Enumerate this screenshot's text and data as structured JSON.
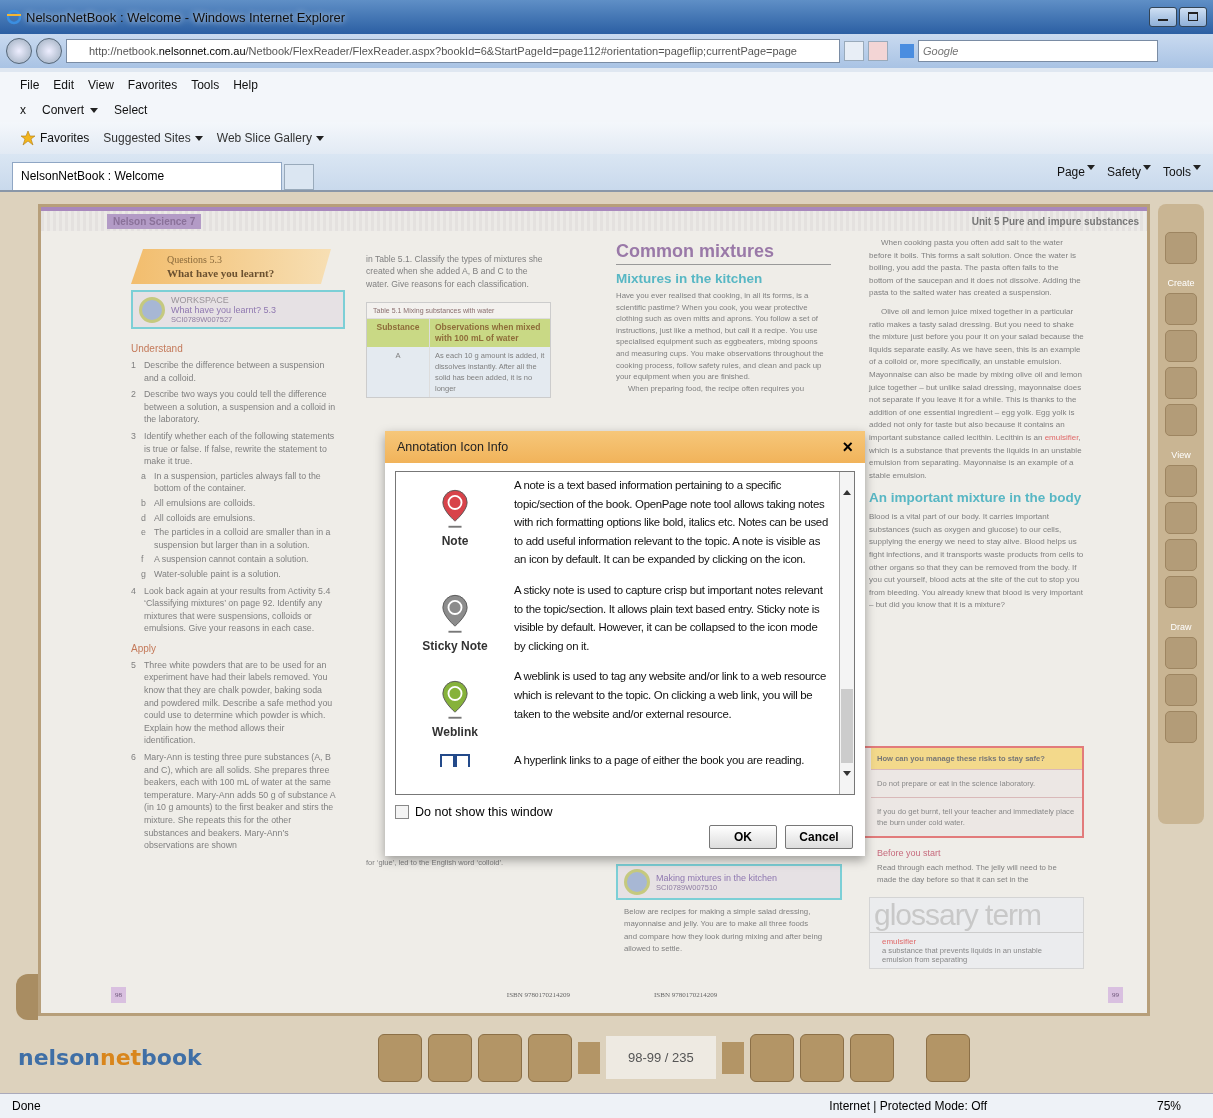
{
  "window": {
    "title": "NelsonNetBook : Welcome - Windows Internet Explorer"
  },
  "address_bar": {
    "url_start": "http://netbook.",
    "url_domain": "nelsonnet.com.au",
    "url_rest": "/Netbook/FlexReader/FlexReader.aspx?bookId=6&StartPageId=page112#orientation=pageflip;currentPage=page",
    "search_placeholder": "Google"
  },
  "menu": [
    "File",
    "Edit",
    "View",
    "Favorites",
    "Tools",
    "Help"
  ],
  "command_bar": {
    "close": "x",
    "convert": "Convert",
    "select": "Select"
  },
  "favorites_bar": {
    "favorites": "Favorites",
    "items": [
      "Suggested Sites",
      "Web Slice Gallery"
    ]
  },
  "tabs": [
    {
      "label": "NelsonNetBook : Welcome",
      "selected": true
    }
  ],
  "tab_commands": [
    "Page",
    "Safety",
    "Tools"
  ],
  "left_page": {
    "series": "Nelson Science 7",
    "questions_label": "Questions 5.3",
    "questions_title": "What have you learnt?",
    "workspace": {
      "label": "WORKSPACE",
      "title": "What have you learnt? 5.3",
      "code": "SCI0789W007527"
    },
    "sections": [
      {
        "heading": "Understand",
        "items": [
          {
            "num": "1",
            "text": "Describe the difference between a suspension and a colloid."
          },
          {
            "num": "2",
            "text": "Describe two ways you could tell the difference between a solution, a suspension and a colloid in the laboratory."
          },
          {
            "num": "3",
            "text": "Identify whether each of the following statements is true or false. If false, rewrite the statement to make it true.",
            "children": [
              {
                "num": "a",
                "text": "In a suspension, particles always fall to the bottom of the container."
              },
              {
                "num": "b",
                "text": "All emulsions are colloids."
              },
              {
                "num": "d",
                "text": "All colloids are emulsions."
              },
              {
                "num": "e",
                "text": "The particles in a colloid are smaller than in a suspension but larger than in a solution."
              },
              {
                "num": "f",
                "text": "A suspension cannot contain a solution."
              },
              {
                "num": "g",
                "text": "Water-soluble paint is a solution."
              }
            ]
          },
          {
            "num": "4",
            "text": "Look back again at your results from Activity 5.4 ‘Classifying mixtures’ on page 92. Identify any mixtures that were suspensions, colloids or emulsions. Give your reasons in each case."
          }
        ]
      },
      {
        "heading": "Apply",
        "items": [
          {
            "num": "5",
            "text": "Three white powders that are to be used for an experiment have had their labels removed. You know that they are chalk powder, baking soda and powdered milk. Describe a safe method you could use to determine which powder is which. Explain how the method allows their identification."
          },
          {
            "num": "6",
            "text": "Mary-Ann is testing three pure substances (A, B and C), which are all solids. She prepares three beakers, each with 100 mL of water at the same temperature. Mary-Ann adds 50 g of substance A (in 10 g amounts) to the first beaker and stirs the mixture. She repeats this for the other substances and beakers. Mary-Ann’s observations are shown"
          }
        ]
      }
    ],
    "intro": "in Table 5.1. Classify the types of mixtures she created when she added A, B and C to the water. Give reasons for each classification.",
    "table": {
      "caption": "Table 5.1 Mixing substances with water",
      "columns": [
        "Substance",
        "Observations when mixed with 100 mL of water"
      ],
      "rows": [
        [
          "A",
          "As each 10 g amount is added, it dissolves instantly. After all the solid has been added, it is no longer"
        ]
      ]
    },
    "tail": "for ‘glue’, led to the English word ‘colloid’.",
    "page_number": "98",
    "isbn": "ISBN 9780170214209"
  },
  "right_page": {
    "unit": "Unit 5 Pure and impure substances",
    "title": "Common mixtures",
    "heading": "Mixtures in the kitchen",
    "paragraphs": [
      "Have you ever realised that cooking, in all its forms, is a scientific pastime? When you cook, you wear protective clothing such as oven mitts and aprons. You follow a set of instructions, just like a method, but call it a recipe. You use specialised equipment such as eggbeaters, mixing spoons and measuring cups. You make observations throughout the cooking process, follow safety rules, and clean and pack up your equipment when you are finished.",
      "When preparing food, the recipe often requires you"
    ],
    "column2": [
      {
        "segments": [
          {
            "text": "When cooking pasta you often add salt to the water before it boils. This forms a salt solution. Once the water is boiling, you add the pasta. The pasta often falls to the bottom of the saucepan and it does not dissolve. Adding the pasta to the salted water has created a suspension."
          }
        ]
      },
      {
        "segments": [
          {
            "text": "Olive oil and lemon juice mixed together in a particular ratio makes a tasty salad dressing. But you need to shake the mixture just before you pour it on your salad because the liquids separate easily. As we have seen, this is an example of a colloid or, more specifically, an unstable emulsion. Mayonnaise can also be made by mixing olive oil and lemon juice together – but unlike salad dressing, mayonnaise does not separate if you leave it for a while. This is thanks to the addition of one essential ingredient – egg yolk. Egg yolk is added not only for taste but also because it contains an important substance called lecithin. Lecithin is an "
          },
          {
            "text": "emulsifier",
            "kind": "term"
          },
          {
            "text": ", which is a substance that prevents the liquids in an unstable emulsion from separating. Mayonnaise is an example of a stable emulsion."
          }
        ]
      }
    ],
    "heading2": "An important mixture in the body",
    "body_paragraph": "Blood is a vital part of our body. It carries important substances (such as oxygen and glucose) to our cells, supplying the energy we need to stay alive. Blood helps us fight infections, and it transports waste products from cells to other organs so that they can be removed from the body. If you cut yourself, blood acts at the site of the cut to stop you from bleeding. You already knew that blood is very important – but did you know that it is a mixture?",
    "risk_table": {
      "header": "How can you manage these risks to stay safe?",
      "rows": [
        "Do not prepare or eat in the science laboratory.",
        "If you do get burnt, tell your teacher and immediately place the burn under cold water."
      ]
    },
    "workspace": {
      "title": "Making mixtures in the kitchen",
      "code": "SCI0789W007510"
    },
    "recipes_text": "Below are recipes for making a simple salad dressing, mayonnaise and jelly. You are to make all three foods and compare how they look during mixing and after being allowed to settle.",
    "before_heading": "Before you start",
    "before_text": "Read through each method. The jelly will need to be made the day before so that it can set in the",
    "glossary": {
      "label": "glossary term",
      "term": "emulsifier",
      "definition": "a substance that prevents liquids in an unstable emulsion from separating"
    },
    "page_number": "99",
    "isbn": "ISBN 9780170214209"
  },
  "tool_panel": {
    "groups": [
      "Create",
      "View",
      "Draw"
    ]
  },
  "dialog": {
    "title": "Annotation Icon Info",
    "close": "×",
    "items": [
      {
        "kind": "note",
        "label": "Note",
        "text": "A note is a text based information pertaining to a specific topic/section of the book. OpenPage note tool allows taking notes with rich formatting options like bold, italics etc. Notes can be used to add useful information relevant to the topic. A note is visible as an icon by default. It can be expanded by clicking on the icon."
      },
      {
        "kind": "sticky",
        "label": "Sticky Note",
        "text": "A sticky note is used to capture crisp but important notes relevant to the topic/section. It allows plain text based entry. Sticky note is visible by default. However, it can be collapsed to the icon mode by clicking on it."
      },
      {
        "kind": "weblink",
        "label": "Weblink",
        "text": "A weblink is used to tag any website and/or link to a web resource which is relevant to the topic. On clicking a web link, you will be taken to the website and/or external resource."
      },
      {
        "kind": "hyperlink",
        "text": "A hyperlink links to a page of either the book you are reading."
      }
    ],
    "checkbox": {
      "label": "Do not show this window",
      "checked": false
    },
    "buttons": [
      "OK",
      "Cancel"
    ]
  },
  "reader_toolbar": {
    "logo": [
      "nelson",
      "net",
      "book"
    ],
    "page_counter": "98-99 / 235"
  },
  "status_bar": {
    "text": "Done",
    "zone": "Internet | Protected Mode: Off",
    "zoom": "75%"
  }
}
